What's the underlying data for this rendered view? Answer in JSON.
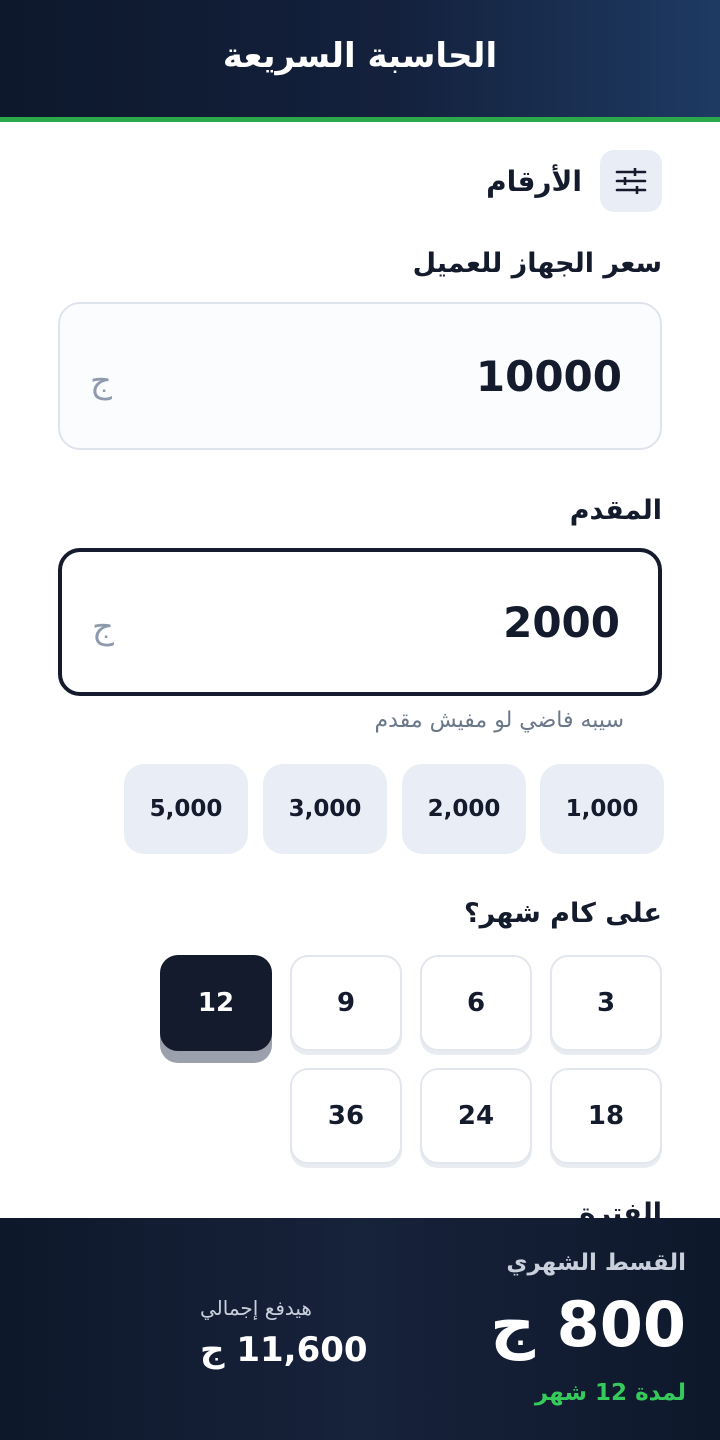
{
  "header": {
    "title": "الحاسبة السريعة"
  },
  "section": {
    "title": "الأرقام",
    "icon": "sliders-icon"
  },
  "price": {
    "label": "سعر الجهاز للعميل",
    "value": "10000",
    "currency": "ج"
  },
  "down_payment": {
    "label": "المقدم",
    "value": "2000",
    "currency": "ج",
    "hint": "سيبه فاضي لو مفيش مقدم",
    "quick_amounts": [
      "1,000",
      "2,000",
      "3,000",
      "5,000"
    ]
  },
  "months": {
    "label": "على كام شهر؟",
    "options": [
      "3",
      "6",
      "9",
      "12",
      "18",
      "24",
      "36"
    ],
    "selected": "12"
  },
  "next_section_peek": "الفترة",
  "footer": {
    "monthly_label": "القسط الشهري",
    "monthly_amount": "800 ج",
    "duration": "لمدة 12 شهر",
    "total_label": "هيدفع إجمالي",
    "total_amount": "11,600 ج"
  },
  "colors": {
    "navy": "#141b2d",
    "accent_green": "#2ba84a",
    "chip_bg": "#e9eef6"
  }
}
